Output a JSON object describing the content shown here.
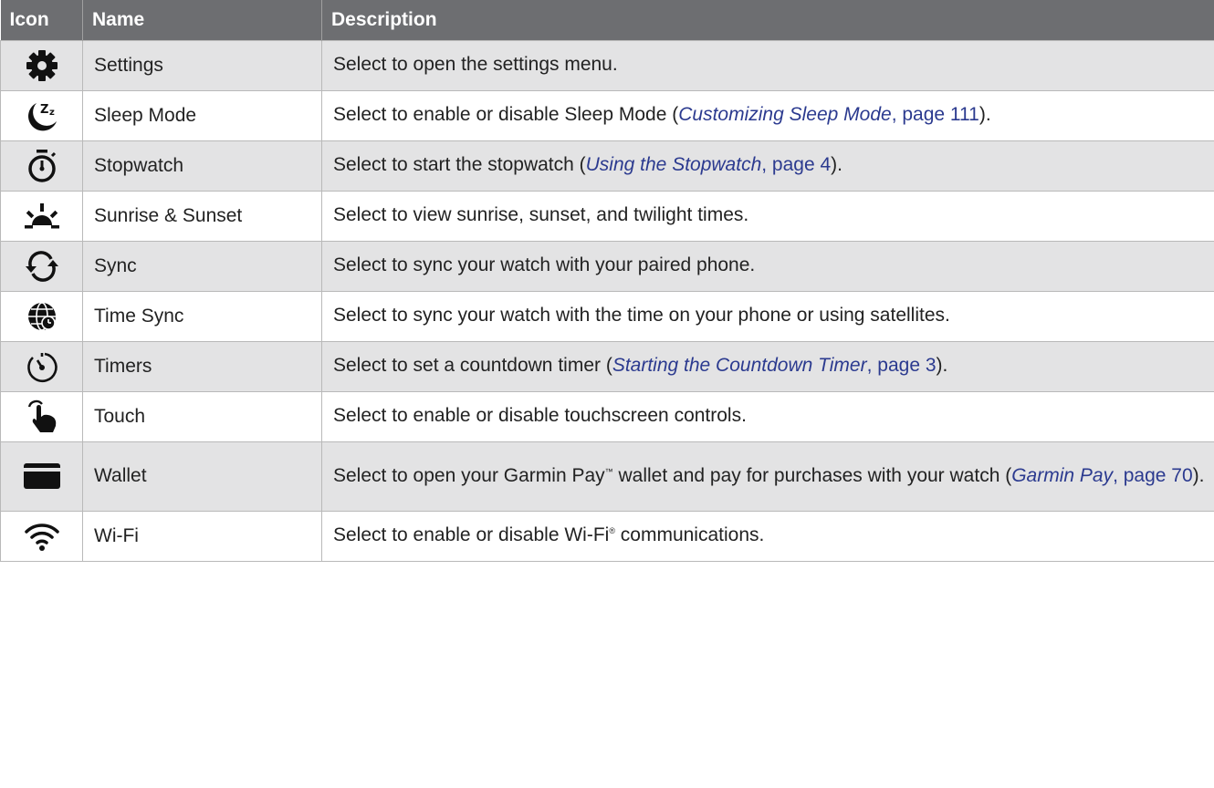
{
  "headers": {
    "icon": "Icon",
    "name": "Name",
    "description": "Description"
  },
  "rows": [
    {
      "icon": "gear-icon",
      "name": "Settings",
      "desc_pre": "Select to open the settings menu.",
      "link_italic": "",
      "link_rest": "",
      "desc_post": ""
    },
    {
      "icon": "moon-sleep-icon",
      "name": "Sleep Mode",
      "desc_pre": "Select to enable or disable Sleep Mode (",
      "link_italic": "Customizing Sleep Mode",
      "link_rest": ", page 111",
      "desc_post": ")."
    },
    {
      "icon": "stopwatch-icon",
      "name": "Stopwatch",
      "desc_pre": "Select to start the stopwatch (",
      "link_italic": "Using the Stopwatch",
      "link_rest": ", page 4",
      "desc_post": ")."
    },
    {
      "icon": "sunrise-icon",
      "name": "Sunrise & Sunset",
      "desc_pre": "Select to view sunrise, sunset, and twilight times.",
      "link_italic": "",
      "link_rest": "",
      "desc_post": ""
    },
    {
      "icon": "sync-icon",
      "name": "Sync",
      "desc_pre": "Select to sync your watch with your paired phone.",
      "link_italic": "",
      "link_rest": "",
      "desc_post": ""
    },
    {
      "icon": "globe-clock-icon",
      "name": "Time Sync",
      "desc_pre": "Select to sync your watch with the time on your phone or using satellites.",
      "link_italic": "",
      "link_rest": "",
      "desc_post": ""
    },
    {
      "icon": "timer-icon",
      "name": "Timers",
      "desc_pre": "Select to set a countdown timer (",
      "link_italic": "Starting the Countdown Timer",
      "link_rest": ", page 3",
      "desc_post": ")."
    },
    {
      "icon": "touch-hand-icon",
      "name": "Touch",
      "desc_pre": "Select to enable or disable touchscreen controls.",
      "link_italic": "",
      "link_rest": "",
      "desc_post": ""
    },
    {
      "icon": "wallet-card-icon",
      "name": "Wallet",
      "desc_pre": "Select to open your Garmin Pay",
      "tm": "™",
      "desc_mid": " wallet and pay for purchases with your watch (",
      "link_italic": "Garmin Pay",
      "link_rest": ", page 70",
      "desc_post": ")."
    },
    {
      "icon": "wifi-icon",
      "name": "Wi-Fi",
      "desc_pre": "Select to enable or disable Wi-Fi",
      "tm": "®",
      "desc_mid": " communications.",
      "link_italic": "",
      "link_rest": "",
      "desc_post": ""
    }
  ],
  "colors": {
    "header_bg": "#6d6e71",
    "shaded_row": "#e3e3e4",
    "link": "#2b3a8f"
  }
}
